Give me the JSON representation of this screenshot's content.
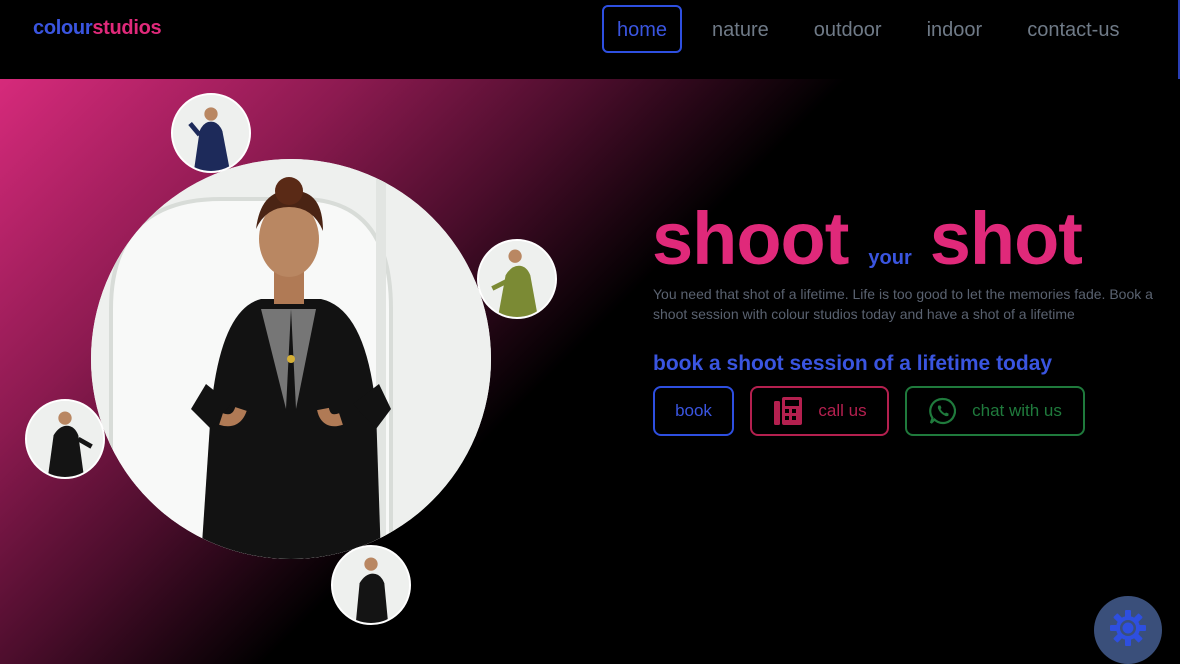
{
  "brand": {
    "part1": "colour",
    "part2": "studios"
  },
  "nav": {
    "items": [
      {
        "label": "home"
      },
      {
        "label": "nature"
      },
      {
        "label": "outdoor"
      },
      {
        "label": "indoor"
      },
      {
        "label": "contact-us"
      }
    ],
    "active": "home"
  },
  "hero": {
    "headline": {
      "word1": "shoot",
      "word2": "your",
      "word3": "shot"
    },
    "description": "You need that shot of a lifetime. Life is too good to let the memories fade. Book a shoot session with colour studios today and have a shot of a lifetime",
    "tagline": "book a shoot session of a lifetime today",
    "buttons": {
      "book": "book",
      "call": "call us",
      "chat": "chat with us"
    },
    "icons": {
      "call": "phone-icon",
      "chat": "whatsapp-icon",
      "theme": "gear-icon"
    }
  },
  "colors": {
    "pink": "#e0297a",
    "blue": "#3a55e0",
    "crimson": "#b4204f",
    "green": "#1f7a3c",
    "background": "#000000"
  }
}
